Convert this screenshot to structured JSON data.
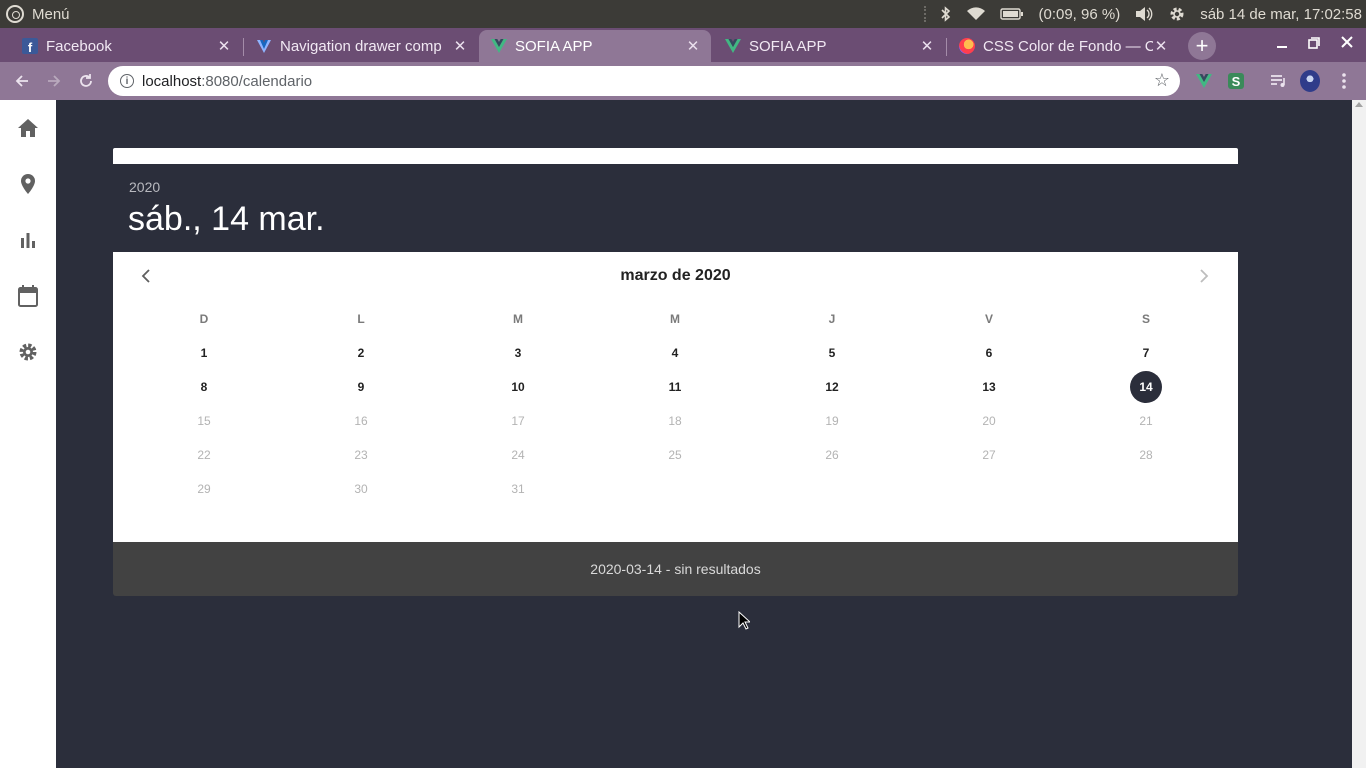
{
  "os": {
    "menu_label": "Menú",
    "battery": "(0:09, 96 %)",
    "datetime": "sáb 14 de mar, 17:02:58"
  },
  "browser": {
    "tabs": [
      {
        "title": "Facebook",
        "favicon": "facebook-icon"
      },
      {
        "title": "Navigation drawer comp",
        "favicon": "vuetify-icon"
      },
      {
        "title": "SOFIA APP",
        "favicon": "vue-icon",
        "active": true
      },
      {
        "title": "SOFIA APP",
        "favicon": "vue-icon"
      },
      {
        "title": "CSS Color de Fondo — Có",
        "favicon": "firefox-icon"
      }
    ],
    "url_host": "localhost",
    "url_path": ":8080/calendario",
    "extension_s_label": "S",
    "accent": "#8f7796",
    "tabstrip_color": "#6b4d73"
  },
  "sidebar": {
    "items": [
      {
        "icon": "home-icon"
      },
      {
        "icon": "map-marker-icon"
      },
      {
        "icon": "bar-chart-icon"
      },
      {
        "icon": "calendar-icon"
      },
      {
        "icon": "settings-gear-icon"
      }
    ]
  },
  "calendar": {
    "year": "2020",
    "selected_date_label": "sáb., 14 mar.",
    "month_label": "marzo de 2020",
    "weekdays": [
      "D",
      "L",
      "M",
      "M",
      "J",
      "V",
      "S"
    ],
    "first_weekday_index": 0,
    "days_in_month": 31,
    "selected_day": 14,
    "last_enabled_day": 14,
    "header_color": "#2b2e3b"
  },
  "footer": {
    "text": "2020-03-14 - sin resultados"
  }
}
